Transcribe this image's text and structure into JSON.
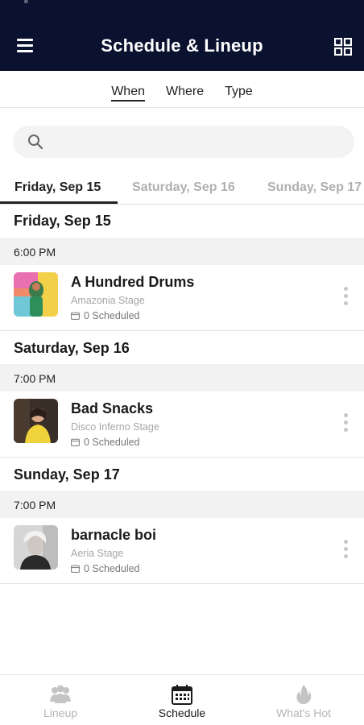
{
  "header": {
    "title": "Schedule & Lineup",
    "status_glyph": "ıı"
  },
  "subtabs": [
    {
      "label": "When",
      "active": true
    },
    {
      "label": "Where",
      "active": false
    },
    {
      "label": "Type",
      "active": false
    }
  ],
  "search": {
    "placeholder": "",
    "value": ""
  },
  "day_tabs": [
    {
      "label": "Friday, Sep 15",
      "active": true
    },
    {
      "label": "Saturday, Sep 16",
      "active": false
    },
    {
      "label": "Sunday, Sep 17",
      "active": false
    }
  ],
  "days": [
    {
      "heading": "Friday, Sep 15",
      "time": "6:00 PM",
      "event": {
        "name": "A Hundred Drums",
        "stage": "Amazonia Stage",
        "scheduled": "0 Scheduled"
      }
    },
    {
      "heading": "Saturday, Sep 16",
      "time": "7:00 PM",
      "event": {
        "name": "Bad Snacks",
        "stage": "Disco Inferno Stage",
        "scheduled": "0 Scheduled"
      }
    },
    {
      "heading": "Sunday, Sep 17",
      "time": "7:00 PM",
      "event": {
        "name": "barnacle boi",
        "stage": "Aeria Stage",
        "scheduled": "0 Scheduled"
      }
    }
  ],
  "bottom_nav": [
    {
      "label": "Lineup",
      "icon": "people-icon",
      "active": false
    },
    {
      "label": "Schedule",
      "icon": "calendar-icon",
      "active": true
    },
    {
      "label": "What's Hot",
      "icon": "flame-icon",
      "active": false
    }
  ],
  "colors": {
    "header_bg": "#0b1230",
    "accent_text": "#1a1a1a",
    "inactive_text": "#b0b0b0"
  }
}
